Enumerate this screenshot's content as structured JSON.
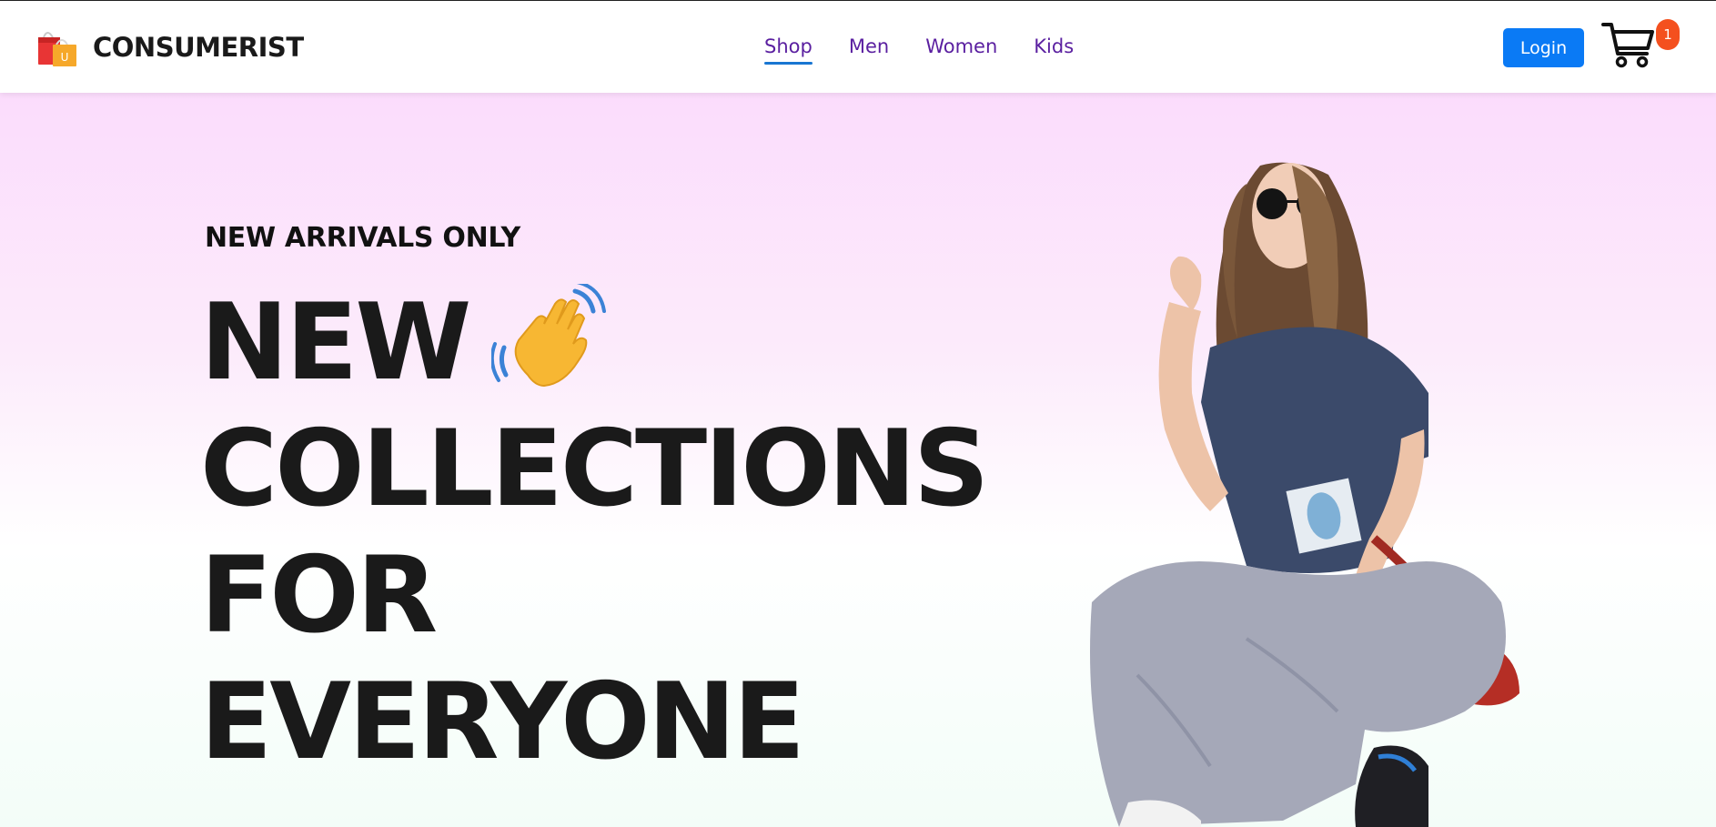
{
  "brand": {
    "name": "CONSUMERIST",
    "logo_icon": "shopping-bags-icon"
  },
  "nav": {
    "items": [
      {
        "label": "Shop",
        "active": true
      },
      {
        "label": "Men",
        "active": false
      },
      {
        "label": "Women",
        "active": false
      },
      {
        "label": "Kids",
        "active": false
      }
    ]
  },
  "header": {
    "login_label": "Login",
    "cart_icon": "cart-icon",
    "cart_count": "1"
  },
  "hero": {
    "eyebrow": "NEW ARRIVALS ONLY",
    "headline_lines": [
      "NEW",
      "COLLECTIONS",
      "FOR",
      "EVERYONE"
    ],
    "emoji": "waving-hand-icon",
    "image": "model-photo"
  },
  "colors": {
    "nav_text": "#5a1fa0",
    "nav_underline": "#1976d2",
    "login_bg": "#0a7af5",
    "badge_bg": "#f4501e",
    "hero_top": "#fbdcfc",
    "hero_bottom": "#f3fdf8"
  }
}
